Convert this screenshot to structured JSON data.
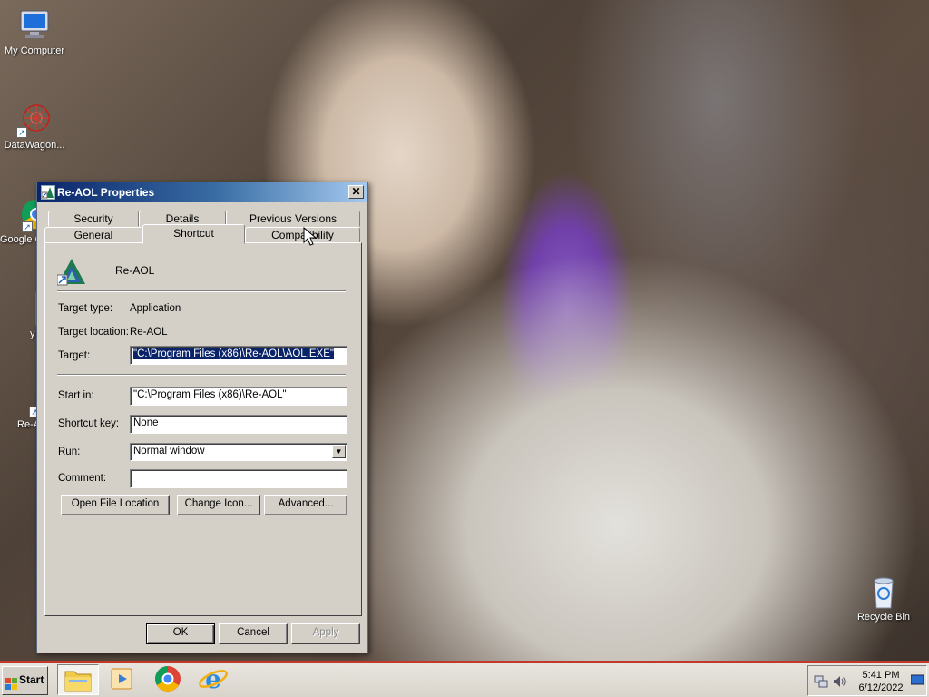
{
  "desktop": {
    "icons": [
      {
        "label": "My Computer"
      },
      {
        "label": "DataWagon..."
      },
      {
        "label": "Google C"
      },
      {
        "label": "y"
      },
      {
        "label": "Re-A"
      },
      {
        "label": "Recycle Bin"
      }
    ]
  },
  "dialog": {
    "title": "Re-AOL Properties",
    "close": "✕",
    "tabs_row1": [
      "Security",
      "Details",
      "Previous Versions"
    ],
    "tabs_row2": [
      "General",
      "Shortcut",
      "Compatibility"
    ],
    "active_tab": "Shortcut",
    "app_name": "Re-AOL",
    "target_type_label": "Target type:",
    "target_type_value": "Application",
    "target_location_label": "Target location:",
    "target_location_value": "Re-AOL",
    "target_label": "Target:",
    "target_value": "\"C:\\Program Files (x86)\\Re-AOL\\AOL.EXE\"",
    "start_in_label": "Start in:",
    "start_in_value": "\"C:\\Program Files (x86)\\Re-AOL\"",
    "shortcut_key_label": "Shortcut key:",
    "shortcut_key_value": "None",
    "run_label": "Run:",
    "run_value": "Normal window",
    "comment_label": "Comment:",
    "comment_value": "",
    "buttons": {
      "open_file_location": "Open File Location",
      "change_icon": "Change Icon...",
      "advanced": "Advanced...",
      "ok": "OK",
      "cancel": "Cancel",
      "apply": "Apply"
    }
  },
  "taskbar": {
    "start_label": "Start",
    "time": "5:41 PM",
    "date": "6/12/2022"
  },
  "colors": {
    "titlebar_start": "#0a246a",
    "titlebar_end": "#a6caf0",
    "dialog_face": "#d4d0c8",
    "selection": "#0a246a",
    "taskbar_border": "#c0392b"
  }
}
